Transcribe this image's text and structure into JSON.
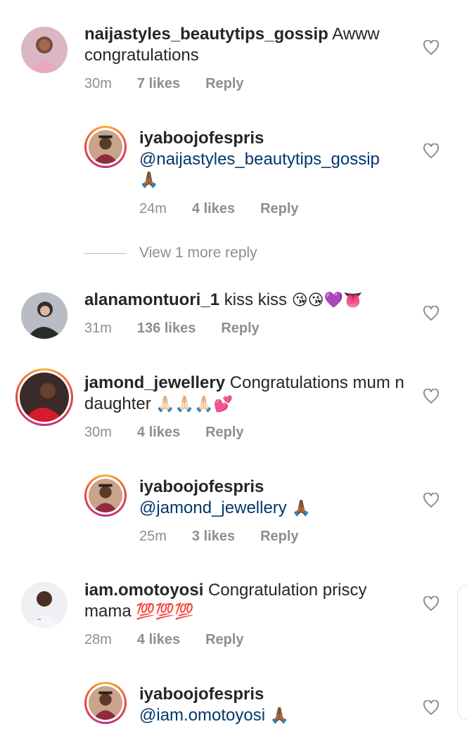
{
  "comments": [
    {
      "user": "naijastyles_beautytips_gossip",
      "text": "Awww congratulations",
      "time": "30m",
      "likes": "7 likes",
      "reply": "Reply",
      "avatar": "woman-in-pink-avatar"
    },
    {
      "user": "iyaboojofespris",
      "mention": "@naijastyles_beautytips_gossip",
      "emoji": "🙏🏾",
      "time": "24m",
      "likes": "4 likes",
      "reply": "Reply",
      "avatar": "graduate-avatar"
    },
    {
      "user": "alanamontuori_1",
      "text": "kiss kiss",
      "emoji": "😘😘💜👅",
      "time": "31m",
      "likes": "136 likes",
      "reply": "Reply",
      "avatar": "woman-selfie-avatar"
    },
    {
      "user": "jamond_jewellery",
      "text": "Congratulations mum n daughter",
      "emoji": "🙏🏻🙏🏻🙏🏻💕",
      "time": "30m",
      "likes": "4 likes",
      "reply": "Reply",
      "avatar": "woman-red-dress-avatar"
    },
    {
      "user": "iyaboojofespris",
      "mention": "@jamond_jewellery",
      "emoji": "🙏🏾",
      "time": "25m",
      "likes": "3 likes",
      "reply": "Reply",
      "avatar": "graduate-avatar"
    },
    {
      "user": "iam.omotoyosi",
      "text": "Congratulation priscy mama",
      "emoji": "💯💯💯",
      "time": "28m",
      "likes": "4 likes",
      "reply": "Reply",
      "avatar": "man-white-shirt-avatar"
    },
    {
      "user": "iyaboojofespris",
      "mention": "@iam.omotoyosi",
      "emoji": "🙏🏾",
      "avatar": "graduate-avatar"
    }
  ],
  "view_more": "View 1 more reply",
  "colors": {
    "text": "#262626",
    "meta": "#8e8e8e",
    "mention": "#00376b"
  },
  "icons": {
    "like": "heart-outline-icon"
  }
}
